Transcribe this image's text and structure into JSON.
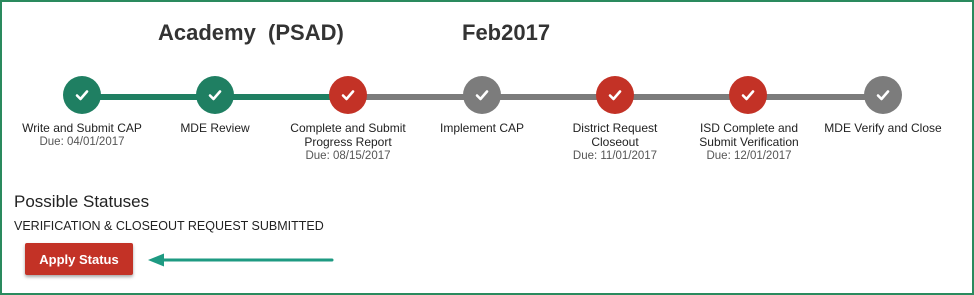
{
  "header": {
    "school": "Academy  (PSAD)",
    "period": "Feb2017"
  },
  "steps": [
    {
      "status": "green",
      "label": "Write and Submit CAP",
      "due": "Due: 04/01/2017"
    },
    {
      "status": "green",
      "label": "MDE Review",
      "due": ""
    },
    {
      "status": "red",
      "label": "Complete and Submit Progress Report",
      "due": "Due: 08/15/2017"
    },
    {
      "status": "gray",
      "label": "Implement CAP",
      "due": ""
    },
    {
      "status": "red",
      "label": "District Request Closeout",
      "due": "Due: 11/01/2017"
    },
    {
      "status": "red",
      "label": "ISD Complete and Submit Verification",
      "due": "Due: 12/01/2017"
    },
    {
      "status": "gray",
      "label": "MDE Verify and Close",
      "due": ""
    }
  ],
  "statuses": {
    "heading": "Possible Statuses",
    "option": "VERIFICATION & CLOSEOUT REQUEST SUBMITTED",
    "apply_label": "Apply Status"
  },
  "colors": {
    "green": "#1f7f62",
    "red": "#c33226",
    "gray": "#7c7c7c",
    "arrow": "#1e9a82"
  },
  "icons": {
    "step": "check-icon",
    "pointer": "arrow-left-icon"
  }
}
